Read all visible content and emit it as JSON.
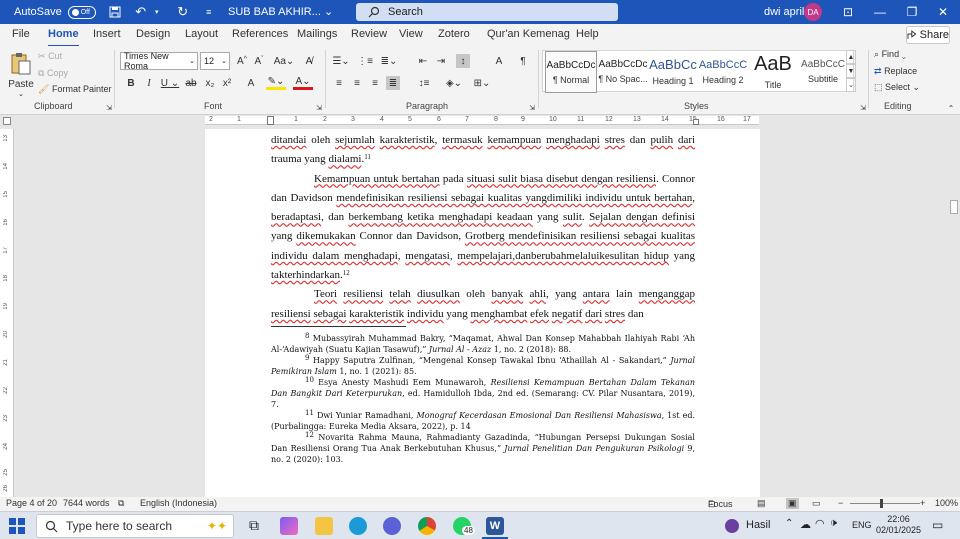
{
  "titlebar": {
    "autosave": "AutoSave",
    "toggle": "Off",
    "doc_title": "SUB BAB AKHIR...",
    "search": "Search",
    "user": "dwi april",
    "initials": "DA"
  },
  "tabs": [
    "File",
    "Home",
    "Insert",
    "Design",
    "Layout",
    "References",
    "Mailings",
    "Review",
    "View",
    "Zotero",
    "Qur'an Kemenag",
    "Help"
  ],
  "share": "Share",
  "ribbon": {
    "clipboard": {
      "paste": "Paste",
      "cut": "Cut",
      "copy": "Copy",
      "painter": "Format Painter",
      "label": "Clipboard"
    },
    "font": {
      "name": "Times New Roma",
      "size": "12",
      "label": "Font"
    },
    "paragraph": {
      "label": "Paragraph"
    },
    "styles": {
      "items": [
        {
          "preview": "AaBbCcDc",
          "name": "¶ Normal"
        },
        {
          "preview": "AaBbCcDc",
          "name": "¶ No Spac..."
        },
        {
          "preview": "AaBbCc",
          "name": "Heading 1"
        },
        {
          "preview": "AaBbCcC",
          "name": "Heading 2"
        },
        {
          "preview": "AaB",
          "name": "Title"
        },
        {
          "preview": "AaBbCcC",
          "name": "Subtitle"
        }
      ],
      "label": "Styles"
    },
    "editing": {
      "find": "Find",
      "replace": "Replace",
      "select": "Select",
      "label": "Editing"
    }
  },
  "ruler": {
    "top": [
      "2",
      "1",
      "1",
      "2",
      "3",
      "4",
      "5",
      "6",
      "7",
      "8",
      "9",
      "10",
      "11",
      "12",
      "13",
      "14",
      "15",
      "16",
      "17",
      "18"
    ],
    "left": [
      "13",
      "14",
      "15",
      "16",
      "17",
      "18",
      "19",
      "20",
      "21",
      "22",
      "23",
      "24",
      "25",
      "26"
    ]
  },
  "document": {
    "p0": {
      "a": "ditandai",
      "b": " oleh ",
      "c": "sejumlah",
      "d": " ",
      "e": "karakteristik",
      "f": ", ",
      "g": "termasuk",
      "h": " ",
      "i": "kemampuan",
      "j": " ",
      "k": "menghadapi",
      "l": " ",
      "m": "stres",
      "n": " dan ",
      "o": "pulih",
      "p": " ",
      "q": "dari",
      "r": " trauma yang ",
      "s": "dialami",
      "t": ".",
      "sup": "11"
    },
    "p1": {
      "a": "Kemampuan untuk bertahan",
      "b": " pada ",
      "c": "situasi sulit biasa disebut dengan resiliensi",
      "d": ". Connor dan Davidson ",
      "e": "mendefinisikan resiliensi sebagai kualitas yangdimiliki individu untuk bertahan",
      "f": ", ",
      "g": "beradaptasi",
      "h": ", dan ",
      "i": "berkembang ketika menghadapi keadaan",
      "j": " yang ",
      "k": "sulit",
      "l": ". ",
      "m": "Sejalan dengan definisi",
      "n": " yang ",
      "o": "dikemukakan",
      "p": " Connor dan Davidson, ",
      "q": "Grotberg mendefinisikan resiliensi sebagai kualitas individu dalam menghadapi",
      "r": ", ",
      "s": "mengatasi",
      "t": ", ",
      "u": "mempelajari,danberubahmelaluikesulitan hidup",
      "v": " yang ",
      "w": "takterhindarkan",
      "x": ".",
      "sup": "12"
    },
    "p2": {
      "a": "Teori",
      "b": " ",
      "c": "resiliensi",
      "d": " ",
      "e": "telah",
      "f": " ",
      "g": "diusulkan",
      "h": " oleh ",
      "i": "banyak",
      "j": " ",
      "k": "ahli",
      "l": ", yang ",
      "m": "antara",
      "n": " lain ",
      "o": "menganggap",
      "p": " ",
      "q": "resiliensi",
      "r": " ",
      "s": "sebagai",
      "t": " ",
      "u": "karakteristik",
      "v": " ",
      "w": "individu",
      "x": " yang ",
      "y": "menghambat",
      "z": " ",
      "aa": "efek",
      "ab": " ",
      "ac": "negatif",
      "ad": " ",
      "ae": "dari",
      "af": " ",
      "ag": "stres",
      "ah": " dan"
    },
    "footnotes": [
      {
        "num": "8",
        "a": " Mubassyirah Muhammad Bakry, “Maqamat, Ahwal Dan Konsep Mahabbah Ilahiyah Rabi ‘Ah Al-‘Adawiyah (Suatu Kajian Tasawuf),” ",
        "i": "Jurnal Al - Azaz",
        "b": " 1, no. 2 (2018): 88."
      },
      {
        "num": "9",
        "a": " Happy Saputra Zulfinan, “Mengenal Konsep Tawakal Ibnu ‘Athaillah Al - Sakandari,” ",
        "i": "Jurnal Pemikiran Islam",
        "b": " 1, no. 1 (2021): 85."
      },
      {
        "num": "10",
        "a": " Esya Anesty Mashudi Eem Munawaroh, ",
        "i": "Resiliensi Kemampuan Bertahan Dalam Tekanan Dan Bangkit Dari Keterpurukan",
        "b": ", ed. Hamidulloh Ibda, 2nd ed. (Semarang: CV. Pilar Nusantara, 2019), 7."
      },
      {
        "num": "11",
        "a": " Dwi Yuniar Ramadhani, ",
        "i": "Monograf Kecerdasan Emosional Dan Resiliensi Mahasiswa",
        "b": ", 1st ed. (Purbalingga: Eureka Media Aksara, 2022), p. 14"
      },
      {
        "num": "12",
        "a": " Novarita Rahma Mauna, Rahmadianty Gazadinda, “Hubungan Persepsi Dukungan Sosial Dan Resiliensi Orang Tua Anak Berkebutuhan Khusus,” ",
        "i": "Jurnal Penelitian Dan Pengukuran Psikologi",
        "b": " 9, no. 2 (2020): 103."
      }
    ]
  },
  "status": {
    "page": "Page 4 of 20",
    "words": "7644 words",
    "lang": "English (Indonesia)",
    "focus": "Focus",
    "zoom": "100%"
  },
  "taskbar": {
    "search": "Type here to search",
    "weather": "Hasil",
    "lang": "ENG",
    "time": "22:06",
    "date": "02/01/2025",
    "badge": "48"
  },
  "colors": {
    "accent": "#1d56b8",
    "avatar": "#c0398a"
  }
}
